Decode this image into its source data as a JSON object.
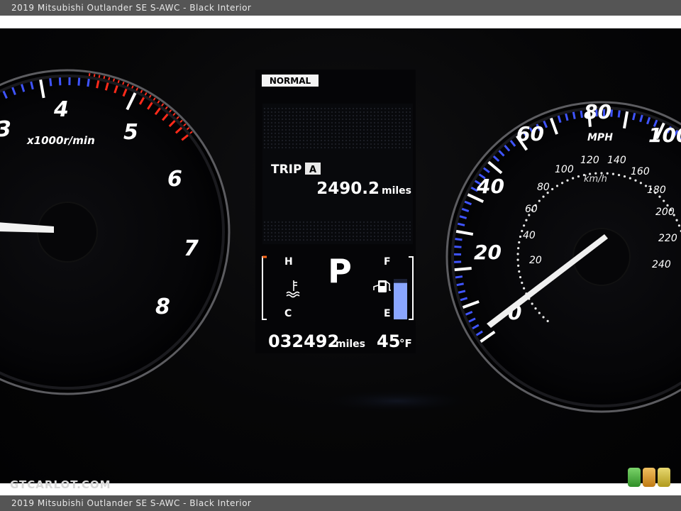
{
  "caption": "2019 Mitsubishi Outlander SE S-AWC - Black Interior",
  "watermark": "GTCARLOT.COM",
  "tachometer": {
    "unit": "x1000r/min",
    "numbers": [
      "3",
      "4",
      "5",
      "6",
      "7",
      "8"
    ]
  },
  "display": {
    "mode": "NORMAL",
    "trip_label": "TRIP",
    "trip_id": "A",
    "trip_value": "2490.2",
    "trip_unit": "miles",
    "temp_hot": "H",
    "temp_cold": "C",
    "gear": "P",
    "fuel_full": "F",
    "fuel_empty": "E",
    "fuel_level": 0.9,
    "odometer_value": "032492",
    "odometer_unit": "miles",
    "outside_temp": "45",
    "outside_temp_unit": "°F",
    "coolant_icon": "coolant-temperature-icon",
    "fuel_icon": "fuel-pump-icon"
  },
  "speedometer": {
    "unit": "MPH",
    "mph_numbers": [
      "0",
      "20",
      "40",
      "60",
      "80",
      "100"
    ],
    "kmh_unit": "km/h",
    "kmh_numbers": [
      "20",
      "40",
      "60",
      "80",
      "100",
      "120",
      "140",
      "160",
      "180",
      "200",
      "220",
      "240"
    ]
  },
  "colors": {
    "blue_ticks": "#3f54ff",
    "red_ticks": "#ff2a1a",
    "needle": "#ffffff",
    "fuel_bar": "#8aa6ff",
    "temp_bracket_hot": "#ff6a1a"
  }
}
